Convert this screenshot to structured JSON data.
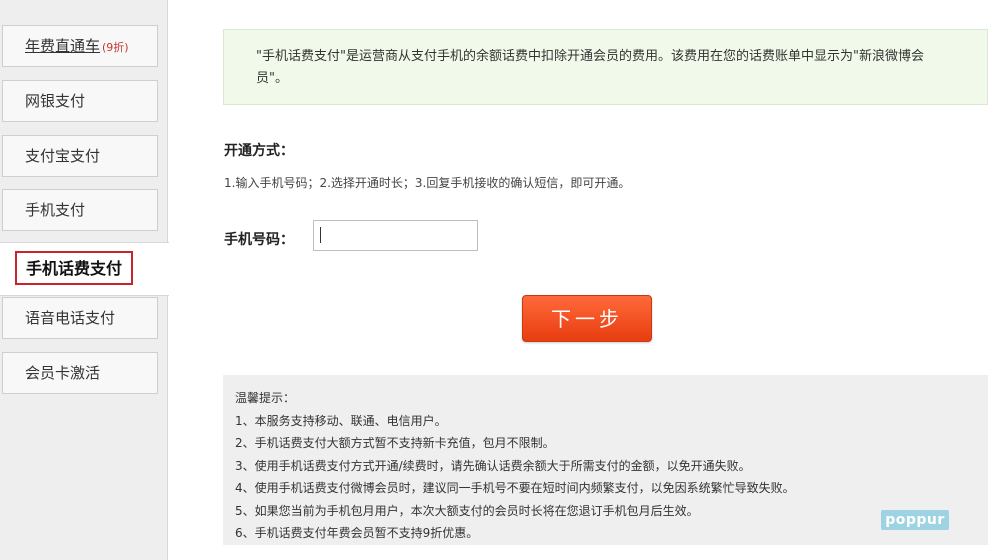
{
  "sidebar": {
    "items": [
      {
        "label": "年费直通车",
        "badge": "(9折)"
      },
      {
        "label": "网银支付"
      },
      {
        "label": "支付宝支付"
      },
      {
        "label": "手机支付"
      },
      {
        "label": "手机话费支付",
        "active": true
      },
      {
        "label": "语音电话支付"
      },
      {
        "label": "会员卡激活"
      }
    ]
  },
  "notice": {
    "text": "\"手机话费支付\"是运营商从支付手机的余额话费中扣除开通会员的费用。该费用在您的话费账单中显示为\"新浪微博会员\"。"
  },
  "method": {
    "title": "开通方式：",
    "steps": "1.输入手机号码；2.选择开通时长；3.回复手机接收的确认短信，即可开通。"
  },
  "form": {
    "phone_label": "手机号码：",
    "phone_value": "",
    "next_label": "下一步"
  },
  "tips": {
    "title": "温馨提示：",
    "lines": [
      "1、本服务支持移动、联通、电信用户。",
      "2、手机话费支付大额方式暂不支持新卡充值，包月不限制。",
      "3、使用手机话费支付方式开通/续费时，请先确认话费余额大于所需支付的金额，以免开通失败。",
      "4、使用手机话费支付微博会员时，建议同一手机号不要在短时间内频繁支付，以免因系统繁忙导致失败。",
      "5、如果您当前为手机包月用户，本次大额支付的会员时长将在您退订手机包月后生效。",
      "6、手机话费支付年费会员暂不支持9折优惠。"
    ]
  },
  "watermark": {
    "text": "poppur"
  },
  "colors": {
    "accent": "#e83d10",
    "active_border": "#c8242b",
    "notice_bg": "#f1faea",
    "tips_bg": "#efefef"
  }
}
